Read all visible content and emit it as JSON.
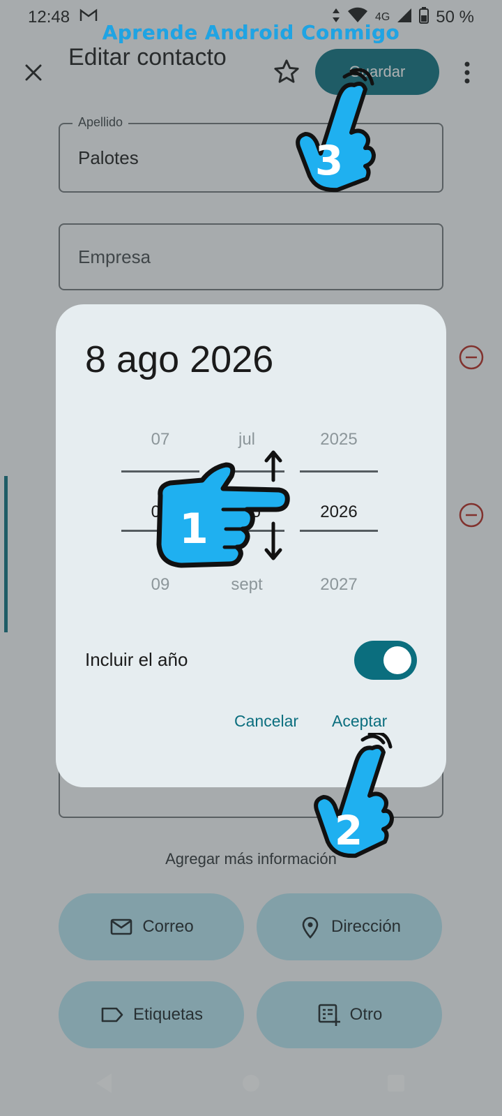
{
  "status_bar": {
    "time": "12:48",
    "network": "4G",
    "battery": "50 %"
  },
  "watermark": "Aprende Android Conmigo",
  "top_bar": {
    "title": "Editar contacto",
    "save_label": "Guardar"
  },
  "fields": [
    {
      "label": "Apellido",
      "value": "Palotes"
    },
    {
      "placeholder": "Empresa"
    }
  ],
  "date_dialog": {
    "selected_date": "8 ago 2026",
    "day_wheel": {
      "prev": "07",
      "current": "08",
      "next": "09"
    },
    "month_wheel": {
      "prev": "jul",
      "current": "ago",
      "next": "sept"
    },
    "year_wheel": {
      "prev": "2025",
      "current": "2026",
      "next": "2027"
    },
    "include_year_label": "Incluir el año",
    "include_year": true,
    "cancel_label": "Cancelar",
    "accept_label": "Aceptar"
  },
  "add_more_info": "Agregar más información",
  "chips": [
    {
      "label": "Correo",
      "icon": "mail-icon"
    },
    {
      "label": "Dirección",
      "icon": "location-pin-icon"
    },
    {
      "label": "Etiquetas",
      "icon": "label-icon"
    },
    {
      "label": "Otro",
      "icon": "other-list-icon"
    }
  ],
  "tutorial_steps": [
    "1",
    "2",
    "3"
  ],
  "colors": {
    "accent": "#0b6e7e",
    "chip_bg": "#b5e3ef",
    "dialog_bg": "#e6edf0",
    "tutorial_hand": "#1fb0f0",
    "remove_red": "#b3261e"
  }
}
